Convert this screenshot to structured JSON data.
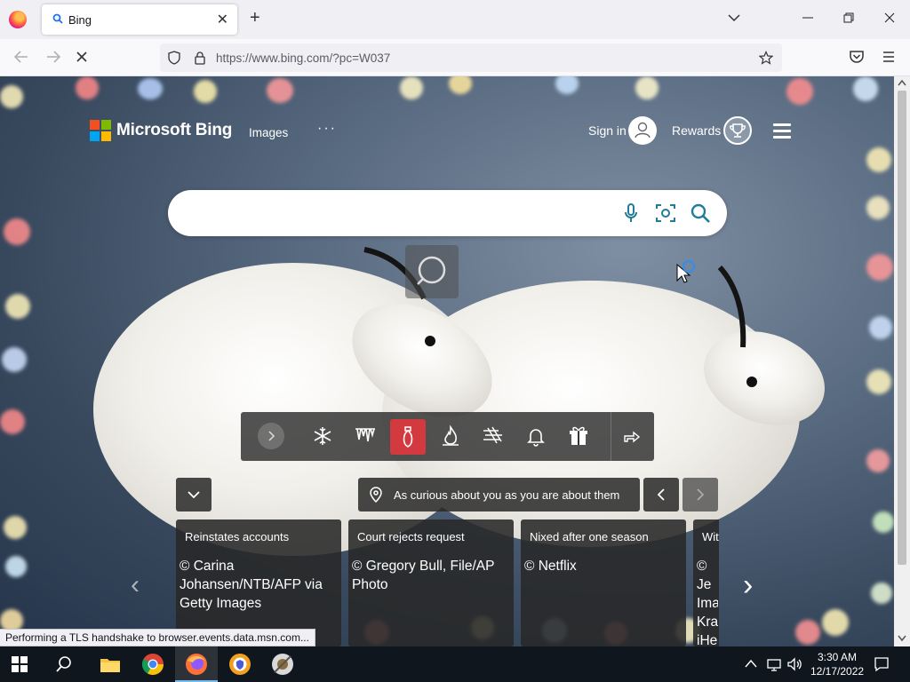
{
  "browser": {
    "tab_title": "Bing",
    "new_tab_symbol": "+",
    "close_tab_symbol": "✕",
    "url": "https://www.bing.com/?pc=W037",
    "status_text": "Performing a TLS handshake to browser.events.data.msn.com..."
  },
  "header": {
    "brand": "Microsoft Bing",
    "nav_images": "Images",
    "more": "···",
    "sign_in": "Sign in",
    "rewards": "Rewards"
  },
  "search": {
    "value": "",
    "placeholder": ""
  },
  "infobar": {
    "location_text": "As curious about you as you are about them"
  },
  "cards": [
    {
      "topic": "Reinstates accounts",
      "credit": "© Carina Johansen/NTB/AFP via Getty Images"
    },
    {
      "topic": "Court rejects request",
      "credit": "© Gregory Bull, File/AP Photo"
    },
    {
      "topic": "Nixed after one season",
      "credit": "© Netflix"
    },
    {
      "topic": "Wit",
      "credit": "© Je Ima Krav iHea"
    }
  ],
  "taskbar": {
    "time": "3:30 AM",
    "date": "12/17/2022"
  },
  "theme_icons": [
    "chevron-right-icon",
    "snowflake-icon",
    "icicles-icon",
    "ornament-icon",
    "fire-icon",
    "wind-icon",
    "bell-icon",
    "gift-icon",
    "share-icon"
  ],
  "colors": {
    "active_theme": "#d23a40",
    "ms_red": "#f25022",
    "ms_green": "#7fba00",
    "ms_blue": "#00a4ef",
    "ms_yellow": "#ffb900",
    "bing_teal": "#1f7d99"
  }
}
